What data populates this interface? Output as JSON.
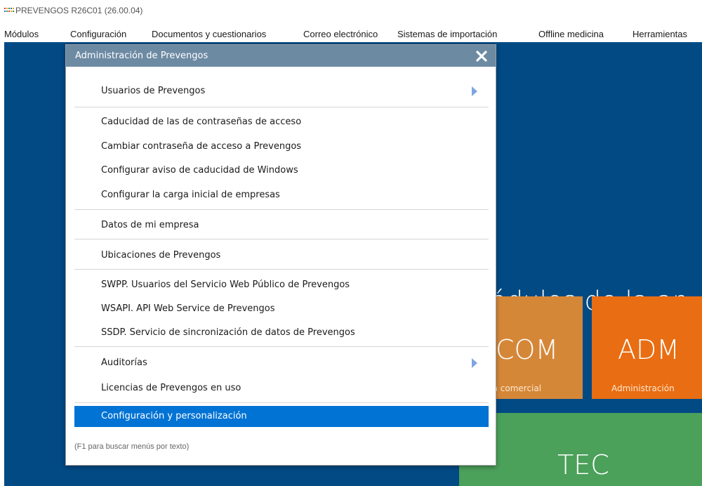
{
  "window": {
    "title": "PREVENGOS R26C01 (26.00.04)",
    "icon_colors": [
      "#e23b3b",
      "#f0a020",
      "#3a8c3a",
      "#2a6fc0"
    ]
  },
  "menubar": [
    {
      "label": "Módulos"
    },
    {
      "label": "Configuración"
    },
    {
      "label": "Documentos y cuestionarios"
    },
    {
      "label": "Correo electrónico"
    },
    {
      "label": "Sistemas de importación"
    },
    {
      "label": "Offline medicina"
    },
    {
      "label": "Herramientas"
    }
  ],
  "desktop": {
    "background": "#024a84",
    "heading": "ódulos de la ap",
    "tiles": [
      {
        "code": "COM",
        "desc": "ón comercial",
        "color": "#d58738"
      },
      {
        "code": "ADM",
        "desc": "Administración",
        "color": "#e96d12"
      },
      {
        "code": "TEC",
        "desc": "",
        "color": "#4ba05a"
      }
    ]
  },
  "dialog": {
    "title": "Administración de Prevengos",
    "close_icon": "close-icon",
    "items": [
      {
        "label": "Usuarios de Prevengos",
        "submenu": true,
        "selected": false
      },
      {
        "label": "Caducidad de las de contraseñas de acceso",
        "submenu": false,
        "selected": false
      },
      {
        "label": "Cambiar contraseña de acceso a Prevengos",
        "submenu": false,
        "selected": false
      },
      {
        "label": "Configurar aviso de caducidad de Windows",
        "submenu": false,
        "selected": false
      },
      {
        "label": "Configurar la carga inicial de empresas",
        "submenu": false,
        "selected": false
      },
      {
        "label": "Datos de mi empresa",
        "submenu": false,
        "selected": false
      },
      {
        "label": "Ubicaciones de Prevengos",
        "submenu": false,
        "selected": false
      },
      {
        "label": "SWPP. Usuarios del Servicio Web Público de Prevengos",
        "submenu": false,
        "selected": false
      },
      {
        "label": "WSAPI. API Web Service de Prevengos",
        "submenu": false,
        "selected": false
      },
      {
        "label": "SSDP. Servicio de sincronización de datos de Prevengos",
        "submenu": false,
        "selected": false
      },
      {
        "label": "Auditorías",
        "submenu": true,
        "selected": false
      },
      {
        "label": "Licencias de Prevengos en uso",
        "submenu": false,
        "selected": false
      },
      {
        "label": "Configuración y personalización",
        "submenu": false,
        "selected": true
      }
    ],
    "hint": "(F1 para buscar menús por texto)",
    "selected_color": "#0173d4"
  }
}
